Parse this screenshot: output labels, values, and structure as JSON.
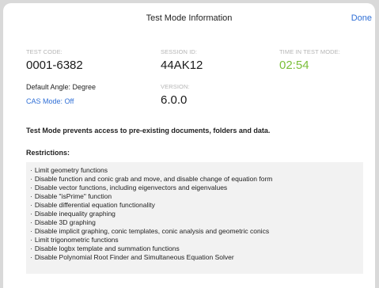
{
  "header": {
    "title": "Test Mode Information",
    "done_label": "Done"
  },
  "info": {
    "test_code_label": "TEST CODE:",
    "test_code": "0001-6382",
    "session_id_label": "SESSION ID:",
    "session_id": "44AK12",
    "time_label": "TIME IN TEST MODE:",
    "time": "02:54",
    "default_angle": "Default Angle: Degree",
    "cas_mode": "CAS Mode: Off",
    "version_label": "VERSION:",
    "version": "6.0.0"
  },
  "statement": "Test Mode prevents access to pre-existing documents, folders and data.",
  "restrictions": {
    "heading": "Restrictions:",
    "items": [
      "Limit geometry functions",
      "Disable function and conic grab and move, and disable change of equation form",
      "Disable vector functions, including eigenvectors and eigenvalues",
      "Disable \"isPrime\" function",
      "Disable differential equation functionality",
      "Disable inequality graphing",
      "Disable 3D graphing",
      "Disable implicit graphing, conic templates, conic analysis and geometric conics",
      "Limit trigonometric functions",
      "Disable logbx template and summation functions",
      "Disable Polynomial Root Finder and Simultaneous Equation Solver"
    ]
  },
  "colors": {
    "accent": "#2f6fd6",
    "time_green": "#7bbf3a"
  }
}
